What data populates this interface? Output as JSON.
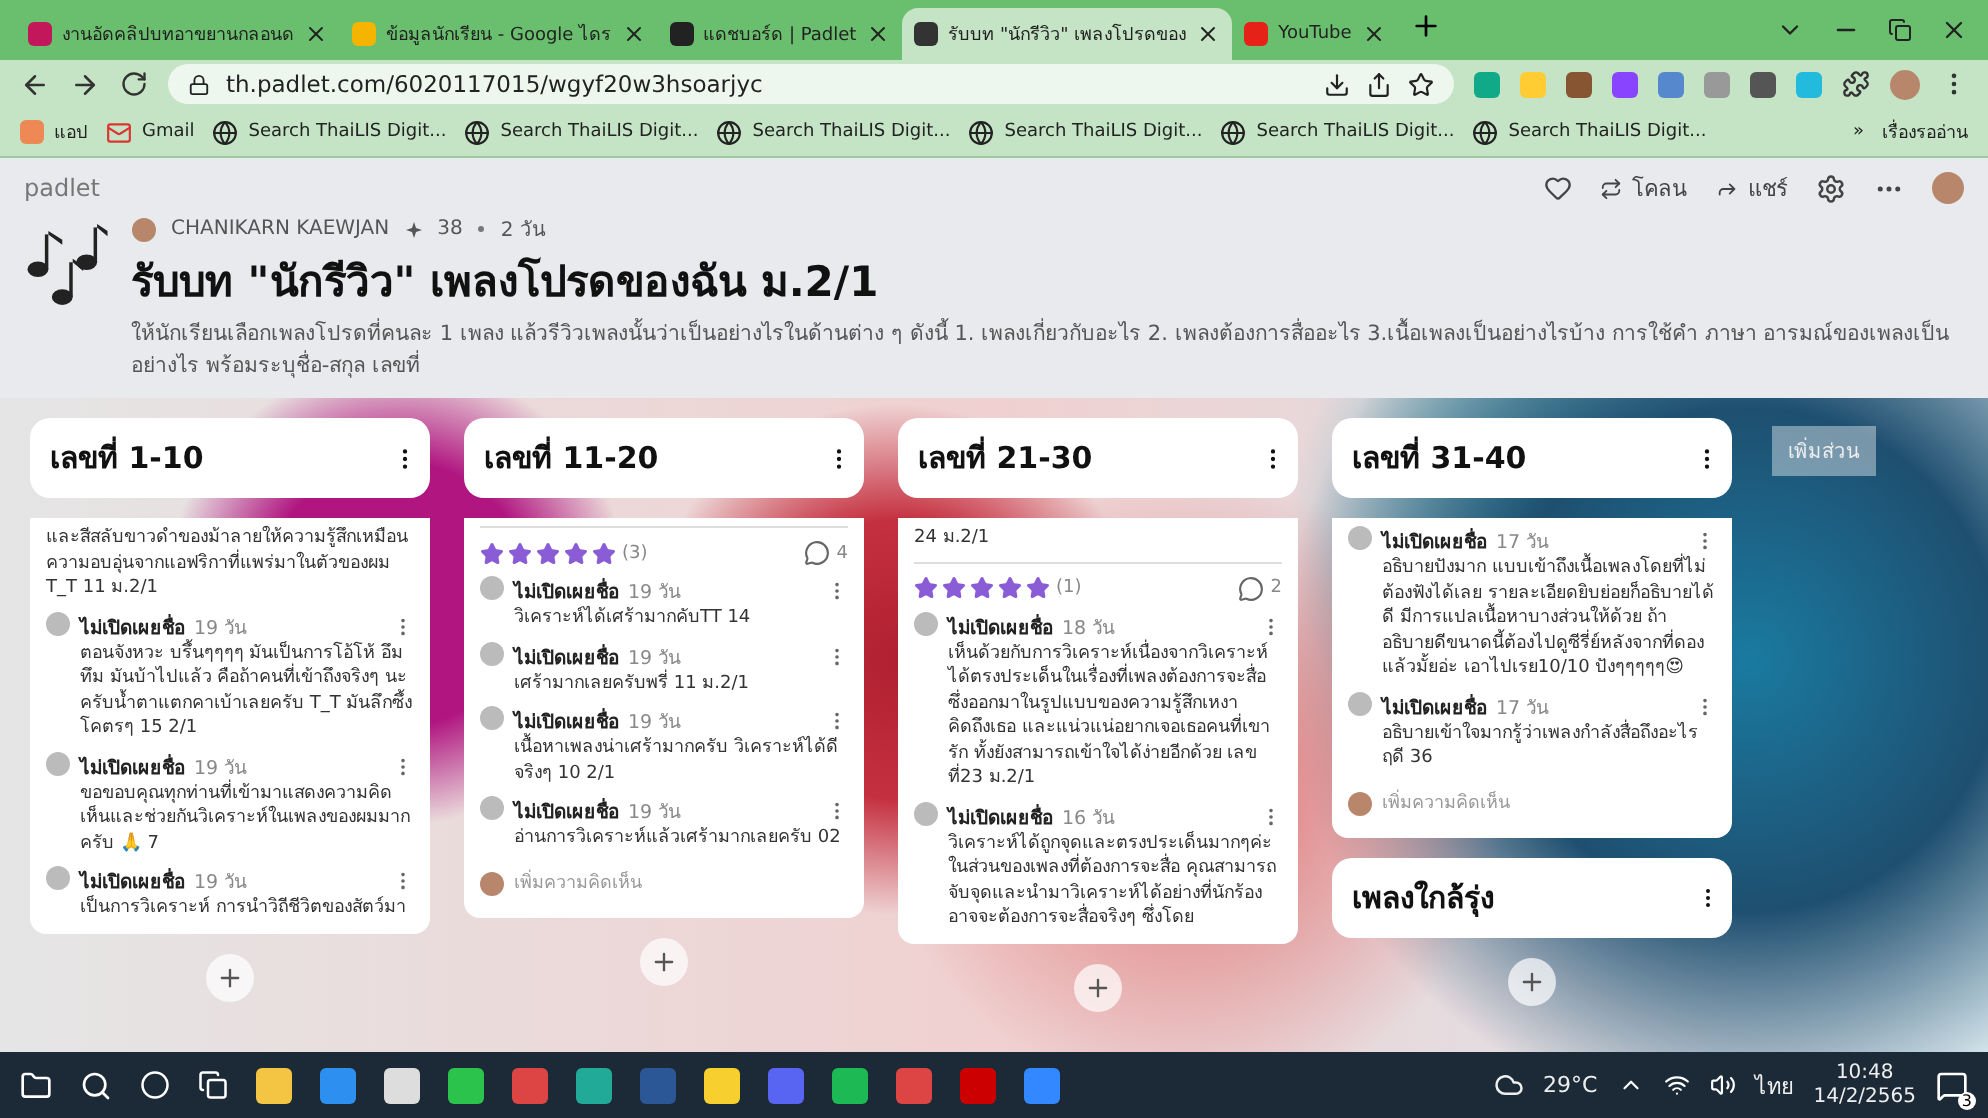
{
  "browser": {
    "tabs": [
      {
        "title": "งานอัดคลิปบทอาขยานกลอนด",
        "selected": false
      },
      {
        "title": "ข้อมูลนักเรียน - Google ไดร",
        "selected": false
      },
      {
        "title": "แดชบอร์ด | Padlet",
        "selected": false
      },
      {
        "title": "รับบท \"นักรีวิว\" เพลงโปรดของ",
        "selected": true
      },
      {
        "title": "YouTube",
        "selected": false
      }
    ],
    "url": "th.padlet.com/6020117015/wgyf20w3hsoarjyc",
    "bookmarks": [
      {
        "label": "แอป",
        "kind": "apps"
      },
      {
        "label": "Gmail",
        "kind": "gmail"
      },
      {
        "label": "Search ThaiLIS Digit...",
        "kind": "globe"
      },
      {
        "label": "Search ThaiLIS Digit...",
        "kind": "globe"
      },
      {
        "label": "Search ThaiLIS Digit...",
        "kind": "globe"
      },
      {
        "label": "Search ThaiLIS Digit...",
        "kind": "globe"
      },
      {
        "label": "Search ThaiLIS Digit...",
        "kind": "globe"
      },
      {
        "label": "Search ThaiLIS Digit...",
        "kind": "globe"
      }
    ],
    "more_bookmarks": "»",
    "reading_list": "เรื่องรออ่าน"
  },
  "padlet": {
    "brand": "padlet",
    "clone": "โคลน",
    "share": "แชร์",
    "author": "CHANIKARN KAEWJAN",
    "likes": "38",
    "age": "2 วัน",
    "title": "รับบท \"นักรีวิว\" เพลงโปรดของฉัน ม.2/1",
    "description": "ให้นักเรียนเลือกเพลงโปรดที่คนละ 1 เพลง แล้วรีวิวเพลงนั้นว่าเป็นอย่างไรในด้านต่าง ๆ ดังนี้ 1. เพลงเกี่ยวกับอะไร 2. เพลงต้องการสื่ออะไร 3.เนื้อเพลงเป็นอย่างไรบ้าง การใช้คำ ภาษา อารมณ์ของเพลงเป็นอย่างไร พร้อมระบุชื่อ-สกุล เลขที่",
    "add_section": "เพิ่มส่วน"
  },
  "columns": [
    {
      "title": "เลขที่ 1-10",
      "cards": [
        {
          "top_text": "และสีสลับขาวดำของม้าลายให้ความรู้สึกเหมือนความอบอุ่นจากแอฟริกาที่แพร่มาในตัวของผม T_T 11 ม.2/1",
          "comments": [
            {
              "name": "ไม่เปิดเผยชื่อ",
              "age": "19 วัน",
              "text": "ตอนจังหวะ บรึ้นๆๆๆๆ มันเป็นการโอ้โห้ อึมทึม มันบ้าไปแล้ว คือถ้าคนที่เข้าถึงจริงๆ นะครับน้ำตาแตกคาเบ้าเลยครับ T_T มันลึกซึ้งโคตรๆ 15 2/1"
            },
            {
              "name": "ไม่เปิดเผยชื่อ",
              "age": "19 วัน",
              "text": "ขอขอบคุณทุกท่านที่เข้ามาแสดงความคิดเห็นและช่วยกันวิเคราะห์ในเพลงของผมมากครับ 🙏 7"
            },
            {
              "name": "ไม่เปิดเผยชื่อ",
              "age": "19 วัน",
              "text": "เป็นการวิเคราะห์ การนำวิถีชีวิตของสัตว์มา"
            }
          ]
        }
      ]
    },
    {
      "title": "เลขที่ 11-20",
      "cards": [
        {
          "rating": {
            "stars": 5,
            "count": "(3)"
          },
          "comment_count": "4",
          "comments": [
            {
              "name": "ไม่เปิดเผยชื่อ",
              "age": "19 วัน",
              "text": "วิเคราะห์ได้เศร้ามากคับTT 14"
            },
            {
              "name": "ไม่เปิดเผยชื่อ",
              "age": "19 วัน",
              "text": "เศร้ามากเลยครับพรี่ 11 ม.2/1"
            },
            {
              "name": "ไม่เปิดเผยชื่อ",
              "age": "19 วัน",
              "text": "เนื้อหาเพลงน่าเศร้ามากครับ วิเคราะห์ได้ดีจริงๆ 10 2/1"
            },
            {
              "name": "ไม่เปิดเผยชื่อ",
              "age": "19 วัน",
              "text": "อ่านการวิเคราะห์แล้วเศร้ามากเลยครับ 02"
            }
          ],
          "add_comment": {
            "placeholder": "เพิ่มความคิดเห็น"
          }
        }
      ]
    },
    {
      "title": "เลขที่ 21-30",
      "cards": [
        {
          "top_text": "24 ม.2/1",
          "rating": {
            "stars": 5,
            "count": "(1)"
          },
          "comment_count": "2",
          "comments": [
            {
              "name": "ไม่เปิดเผยชื่อ",
              "age": "18 วัน",
              "text": "เห็นด้วยกับการวิเคราะห์เนื่องจากวิเคราะห์ได้ตรงประเด็นในเรื่องที่เพลงต้องการจะสื่อ ซึ่งออกมาในรูปแบบของความรู้สึกเหงา คิดถึงเธอ และแน่วแน่อยากเจอเธอคนที่เขารัก ทั้งยังสามารถเข้าใจได้ง่ายอีกด้วย เลขที่23 ม.2/1"
            },
            {
              "name": "ไม่เปิดเผยชื่อ",
              "age": "16 วัน",
              "text": "วิเคราะห์ได้ถูกจุดและตรงประเด็นมากๆค่ะ ในส่วนของเพลงที่ต้องการจะสื่อ คุณสามารถจับจุดและนำมาวิเคราะห์ได้อย่างที่นักร้องอาจจะต้องการจะสื่อจริงๆ ซึ่งโดย"
            }
          ]
        }
      ]
    },
    {
      "title": "เลขที่ 31-40",
      "cards": [
        {
          "comments": [
            {
              "name": "ไม่เปิดเผยชื่อ",
              "age": "17 วัน",
              "text": "อธิบายปังมาก แบบเข้าถึงเนื้อเพลงโดยที่ไม่ต้องฟังได้เลย รายละเอียดยิบย่อยก็อธิบายได้ดี มีการแปลเนื้อหาบางส่วนให้ด้วย ถ้าอธิบายดีขนาดนี้ต้องไปดูซีรี่ย์หลังจากที่ดองแล้วมั้ยอ่ะ เอาไปเรย10/10 ปังๆๆๆๆๆ😍"
            },
            {
              "name": "ไม่เปิดเผยชื่อ",
              "age": "17 วัน",
              "text": "อธิบายเข้าใจมากรู้ว่าเพลงกำลังสื่อถึงอะไร ฤดี 36"
            }
          ],
          "add_comment": {
            "placeholder": "เพิ่มความคิดเห็น"
          }
        },
        {
          "title": "เพลงใกล้รุ่ง"
        }
      ]
    }
  ],
  "taskbar": {
    "temperature": "29°C",
    "language": "ไทย",
    "time": "10:48",
    "date": "14/2/2565",
    "notifications": "3"
  }
}
